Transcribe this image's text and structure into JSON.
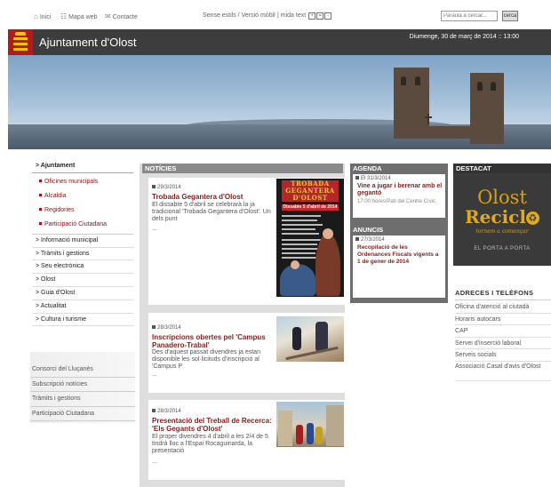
{
  "topbar": {
    "links": [
      {
        "icon": "home-icon",
        "label": "Inici"
      },
      {
        "icon": "sitemap-icon",
        "label": "Mapa web"
      },
      {
        "icon": "mail-icon",
        "label": "Contacte"
      }
    ],
    "accessibility": "Sense estils / Versió mòbil",
    "text_size_label": "| mida text",
    "text_size_buttons": [
      "+",
      "=",
      "-"
    ],
    "search_placeholder": "Paraula a cercar...",
    "search_button": "cerca"
  },
  "header": {
    "title": "Ajuntament d'Olost",
    "date": "Diumenge, 30 de març de 2014 :: 13:00",
    "brand_color": "#3d3d3d"
  },
  "nav": {
    "head": "> Ajuntament",
    "subitems": [
      "Oficines municipals",
      "Alcaldia",
      "Regidories",
      "Participació Ciutadana"
    ],
    "items": [
      "> Informació municipal",
      "> Tràmits i gestions",
      "> Seu electrònica",
      "> Olost",
      "> Guia d'Olost",
      "> Actualitat",
      "> Cultura i turisme"
    ]
  },
  "left_links": [
    "Consorci del Lluçanès",
    "Subscripció notícies",
    "Tràmits i gestions",
    "Participació Ciutadana"
  ],
  "news": {
    "heading": "NOTÍCIES",
    "items": [
      {
        "date": "29/3/2014",
        "title": "Trobada Gegantera d'Olost",
        "body": "El dissabte 5 d'abril se celebrarà la ja tradicional 'Trobada Gegantera d'Olost'. Un dels punt",
        "more": "..."
      },
      {
        "date": "28/3/2014",
        "title": "Inscripcions obertes pel 'Campus Panadero-Trabal'",
        "body": "Des d'aquest passat divendres ja estan disponible les sol·licituds d'inscripció al 'Campus P",
        "more": "..."
      },
      {
        "date": "28/3/2014",
        "title": "Presentació del Treball de Recerca: 'Els Gegants d'Olost'",
        "body": "El proper divendres 4 d'abril a les 2/4 de 5 tindrà lloc a l'Espai Rocaguinarda, la presentació",
        "more": "..."
      }
    ],
    "poster": {
      "title": "TROBADA GEGANTERA D'OLOST",
      "subtitle": "Dissabte 5 d'abril de 2014"
    }
  },
  "agenda": {
    "heading": "AGENDA",
    "date": "El 31/3/2014",
    "title": "Vine a jugar i berenar amb el gegantó",
    "meta": "17:00 hores/Pati del Centre Cívic"
  },
  "anuncis": {
    "heading": "ANUNCIS",
    "date": "27/3/2014",
    "title": "Recopilació de les Ordenances Fiscals vigents a 1 de gener de 2014"
  },
  "destacat": {
    "heading": "DESTACAT",
    "line1": "Olost",
    "line2": "Recicl",
    "tagline": "tornem a començar",
    "porta": "EL PORTA A PORTA"
  },
  "adreces": {
    "heading": "ADRECES I TELÈFONS",
    "items": [
      "Oficina d'atenció al ciutadà",
      "Horaris autocars",
      "CAP",
      "Servei d'inserció laboral",
      "Serveis socials",
      "Associació Casal d'avis d'Olost"
    ]
  }
}
